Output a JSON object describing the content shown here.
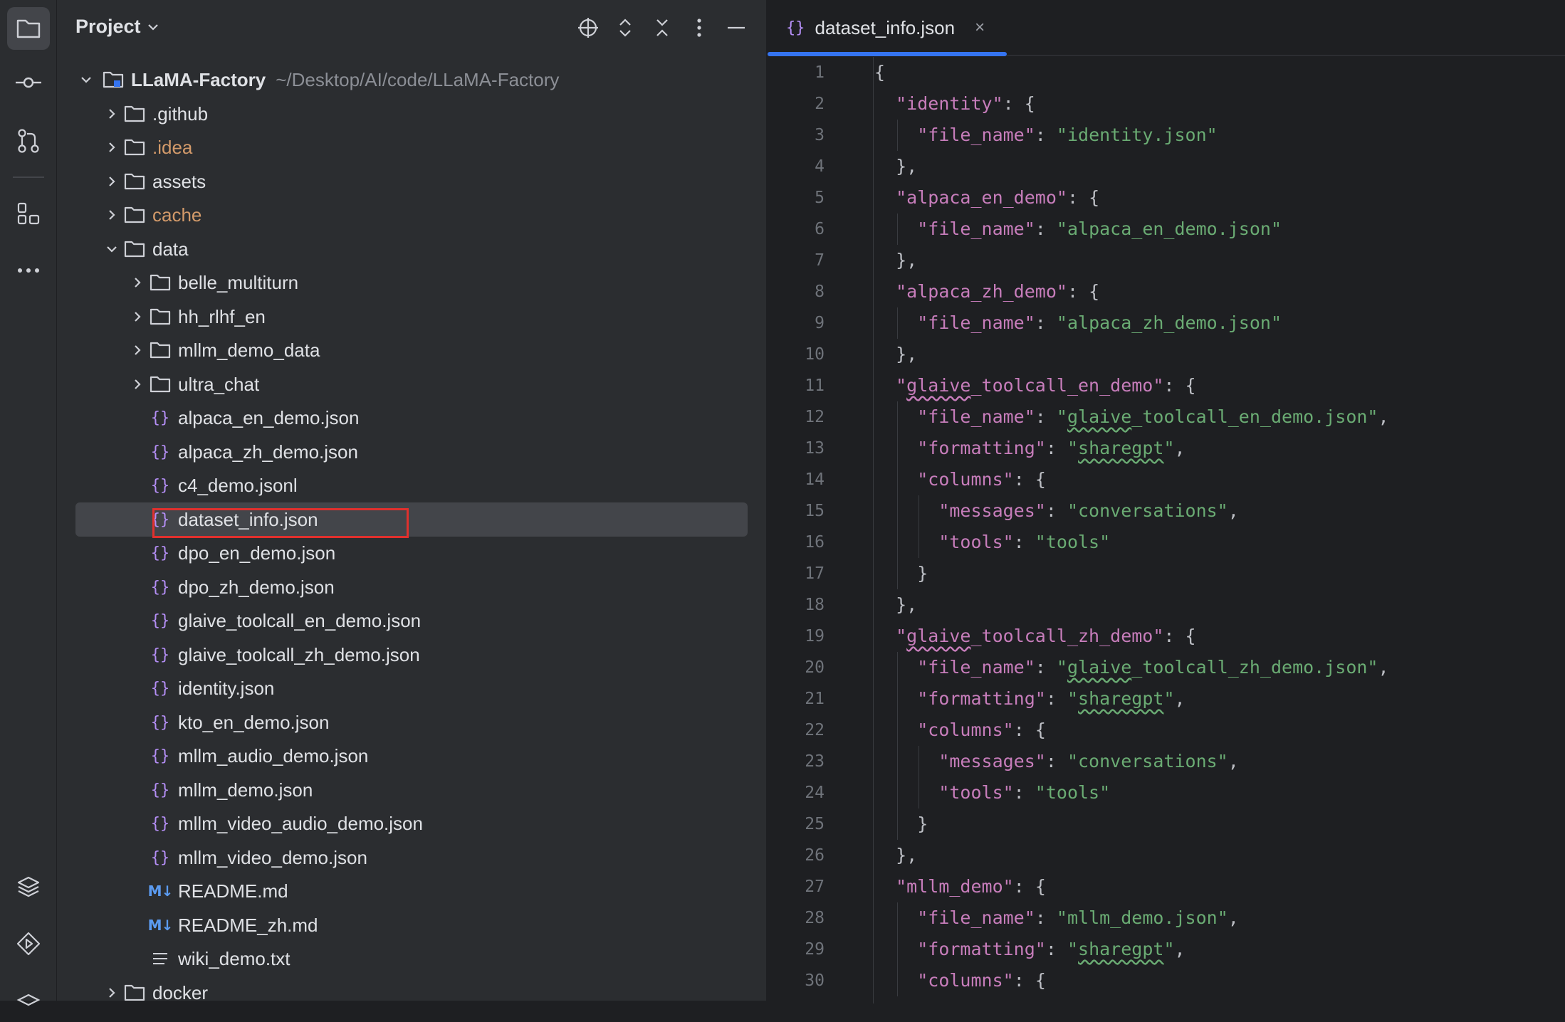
{
  "activity_bar": {
    "items": [
      {
        "name": "project-folder-icon",
        "active": true
      },
      {
        "name": "commit-icon"
      },
      {
        "name": "pull-requests-icon"
      },
      {
        "name": "structure-icon"
      },
      {
        "name": "more-icon"
      }
    ],
    "bottom_items": [
      {
        "name": "layers-icon"
      },
      {
        "name": "services-run-icon"
      }
    ]
  },
  "project_panel": {
    "title": "Project",
    "root": {
      "label": "LLaMA-Factory",
      "path": "~/Desktop/AI/code/LLaMA-Factory"
    },
    "tree": [
      {
        "label": ".github",
        "type": "folder",
        "depth": 1,
        "expanded": false
      },
      {
        "label": ".idea",
        "type": "folder",
        "depth": 1,
        "expanded": false,
        "highlight": "orange"
      },
      {
        "label": "assets",
        "type": "folder",
        "depth": 1,
        "expanded": false
      },
      {
        "label": "cache",
        "type": "folder",
        "depth": 1,
        "expanded": false,
        "highlight": "orange"
      },
      {
        "label": "data",
        "type": "folder",
        "depth": 1,
        "expanded": true
      },
      {
        "label": "belle_multiturn",
        "type": "folder",
        "depth": 2,
        "expanded": false
      },
      {
        "label": "hh_rlhf_en",
        "type": "folder",
        "depth": 2,
        "expanded": false
      },
      {
        "label": "mllm_demo_data",
        "type": "folder",
        "depth": 2,
        "expanded": false
      },
      {
        "label": "ultra_chat",
        "type": "folder",
        "depth": 2,
        "expanded": false
      },
      {
        "label": "alpaca_en_demo.json",
        "type": "json",
        "depth": 2
      },
      {
        "label": "alpaca_zh_demo.json",
        "type": "json",
        "depth": 2
      },
      {
        "label": "c4_demo.jsonl",
        "type": "json",
        "depth": 2
      },
      {
        "label": "dataset_info.json",
        "type": "json",
        "depth": 2,
        "selected": true
      },
      {
        "label": "dpo_en_demo.json",
        "type": "json",
        "depth": 2
      },
      {
        "label": "dpo_zh_demo.json",
        "type": "json",
        "depth": 2
      },
      {
        "label": "glaive_toolcall_en_demo.json",
        "type": "json",
        "depth": 2
      },
      {
        "label": "glaive_toolcall_zh_demo.json",
        "type": "json",
        "depth": 2
      },
      {
        "label": "identity.json",
        "type": "json",
        "depth": 2
      },
      {
        "label": "kto_en_demo.json",
        "type": "json",
        "depth": 2
      },
      {
        "label": "mllm_audio_demo.json",
        "type": "json",
        "depth": 2
      },
      {
        "label": "mllm_demo.json",
        "type": "json",
        "depth": 2
      },
      {
        "label": "mllm_video_audio_demo.json",
        "type": "json",
        "depth": 2
      },
      {
        "label": "mllm_video_demo.json",
        "type": "json",
        "depth": 2
      },
      {
        "label": "README.md",
        "type": "markdown",
        "depth": 2
      },
      {
        "label": "README_zh.md",
        "type": "markdown",
        "depth": 2
      },
      {
        "label": "wiki_demo.txt",
        "type": "text",
        "depth": 2
      },
      {
        "label": "docker",
        "type": "folder",
        "depth": 1,
        "expanded": false
      }
    ],
    "md_badge": "M↓"
  },
  "editor": {
    "tab": {
      "label": "dataset_info.json",
      "close": "×"
    },
    "lines": [
      "{",
      "  \"identity\": {",
      "    \"file_name\": \"identity.json\"",
      "  },",
      "  \"alpaca_en_demo\": {",
      "    \"file_name\": \"alpaca_en_demo.json\"",
      "  },",
      "  \"alpaca_zh_demo\": {",
      "    \"file_name\": \"alpaca_zh_demo.json\"",
      "  },",
      "  \"glaive_toolcall_en_demo\": {",
      "    \"file_name\": \"glaive_toolcall_en_demo.json\",",
      "    \"formatting\": \"sharegpt\",",
      "    \"columns\": {",
      "      \"messages\": \"conversations\",",
      "      \"tools\": \"tools\"",
      "    }",
      "  },",
      "  \"glaive_toolcall_zh_demo\": {",
      "    \"file_name\": \"glaive_toolcall_zh_demo.json\",",
      "    \"formatting\": \"sharegpt\",",
      "    \"columns\": {",
      "      \"messages\": \"conversations\",",
      "      \"tools\": \"tools\"",
      "    }",
      "  },",
      "  \"mllm_demo\": {",
      "    \"file_name\": \"mllm_demo.json\",",
      "    \"formatting\": \"sharegpt\",",
      "    \"columns\": {"
    ]
  },
  "colors": {
    "accent": "#3574f0",
    "selection_box": "#e0302d",
    "json_key": "#c77dbb",
    "json_string": "#6aab73",
    "ignored_folder": "#d39a6a"
  }
}
